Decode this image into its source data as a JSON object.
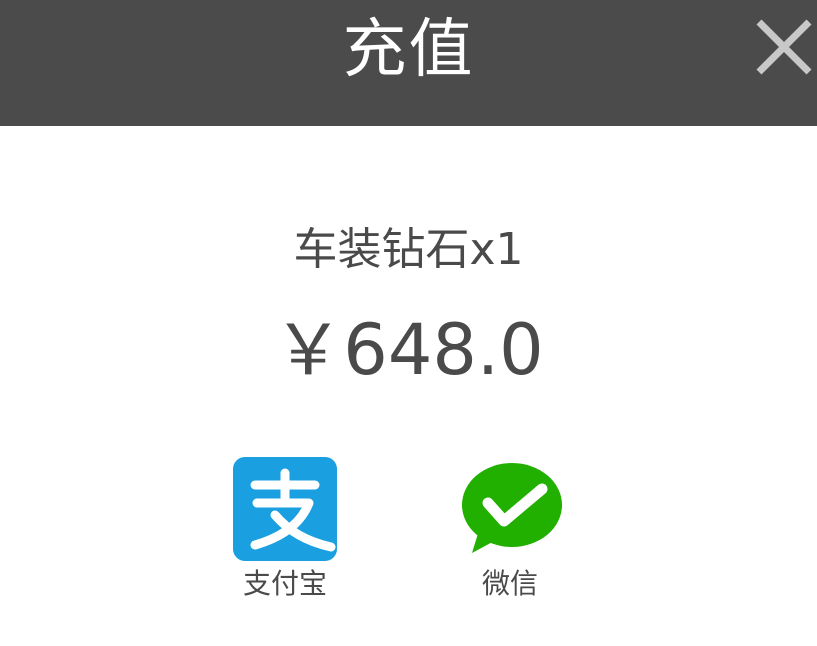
{
  "header": {
    "title": "充值",
    "close_icon": "close-icon",
    "background": "#4b4b4b"
  },
  "product": {
    "name": "车装钻石x1",
    "price": "￥648.0"
  },
  "payment_methods": [
    {
      "label": "支付宝",
      "icon": "alipay-icon",
      "color": "#1a9fe0"
    },
    {
      "label": "微信",
      "icon": "wechat-pay-icon",
      "color": "#22b000"
    }
  ]
}
